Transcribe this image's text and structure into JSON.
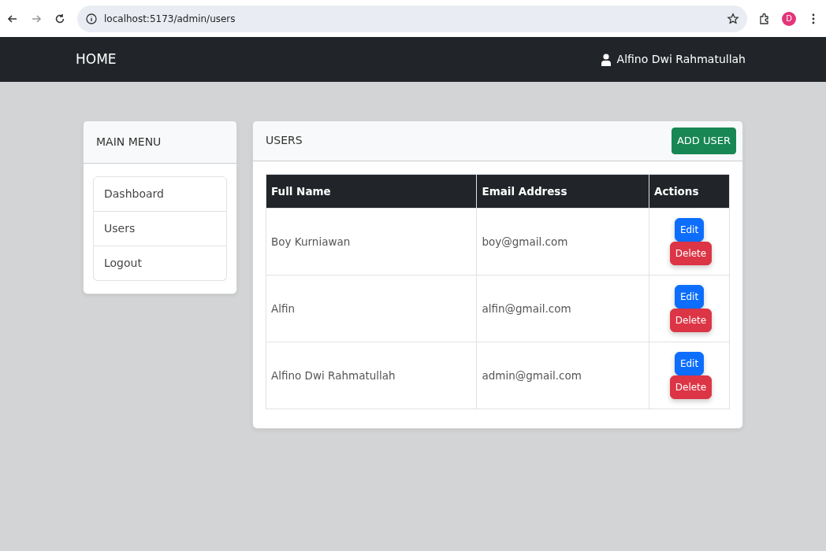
{
  "browser": {
    "url": "localhost:5173/admin/users",
    "profile_initial": "D"
  },
  "navbar": {
    "brand": "HOME",
    "user": "Alfino Dwi Rahmatullah"
  },
  "sidebar": {
    "title": "MAIN MENU",
    "items": [
      {
        "label": "Dashboard"
      },
      {
        "label": "Users"
      },
      {
        "label": "Logout"
      }
    ]
  },
  "users_panel": {
    "title": "USERS",
    "add_button": "ADD USER",
    "table": {
      "columns": [
        "Full Name",
        "Email Address",
        "Actions"
      ],
      "rows": [
        {
          "full_name": "Boy Kurniawan",
          "email": "boy@gmail.com",
          "actions": [
            {
              "label": "Edit",
              "kind": "edit"
            },
            {
              "label": "Delete",
              "kind": "delete"
            }
          ]
        },
        {
          "full_name": "Alfin",
          "email": "alfin@gmail.com",
          "actions": [
            {
              "label": "Edit",
              "kind": "edit"
            },
            {
              "label": "Delete",
              "kind": "delete"
            }
          ]
        },
        {
          "full_name": "Alfino Dwi Rahmatullah",
          "email": "admin@gmail.com",
          "actions": [
            {
              "label": "Edit",
              "kind": "edit"
            },
            {
              "label": "Delete",
              "kind": "delete"
            }
          ]
        }
      ]
    }
  }
}
